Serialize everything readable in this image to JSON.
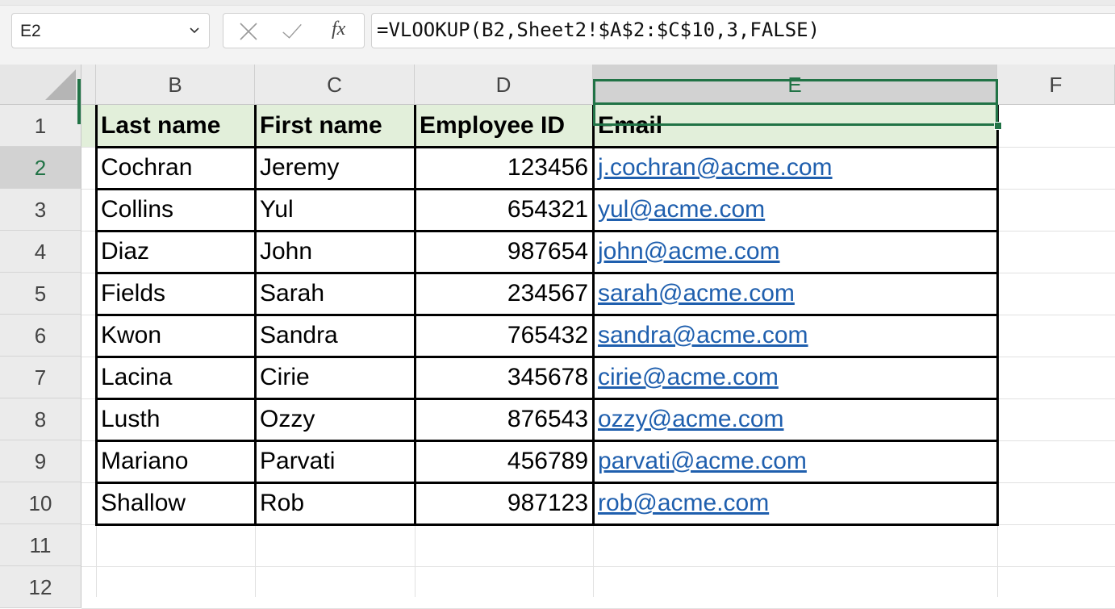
{
  "formula_bar": {
    "name_box": "E2",
    "fx": "fx",
    "formula": "=VLOOKUP(B2,Sheet2!$A$2:$C$10,3,FALSE)"
  },
  "columns": [
    "B",
    "C",
    "D",
    "E",
    "F"
  ],
  "selected_column": "E",
  "rows": [
    "1",
    "2",
    "3",
    "4",
    "5",
    "6",
    "7",
    "8",
    "9",
    "10",
    "11",
    "12"
  ],
  "selected_row": "2",
  "table": {
    "headers": [
      "Last name",
      "First name",
      "Employee ID",
      "Email"
    ],
    "records": [
      [
        "Cochran",
        "Jeremy",
        "123456",
        "j.cochran@acme.com"
      ],
      [
        "Collins",
        "Yul",
        "654321",
        "yul@acme.com"
      ],
      [
        "Diaz",
        "John",
        "987654",
        "john@acme.com"
      ],
      [
        "Fields",
        "Sarah",
        "234567",
        "sarah@acme.com"
      ],
      [
        "Kwon",
        "Sandra",
        "765432",
        "sandra@acme.com"
      ],
      [
        "Lacina",
        "Cirie",
        "345678",
        "cirie@acme.com"
      ],
      [
        "Lusth",
        "Ozzy",
        "876543",
        "ozzy@acme.com"
      ],
      [
        "Mariano",
        "Parvati",
        "456789",
        "parvati@acme.com"
      ],
      [
        "Shallow",
        "Rob",
        "987123",
        "rob@acme.com"
      ]
    ]
  },
  "colors": {
    "accent": "#217346",
    "header_fill": "#e2efda",
    "link": "#1f5fae"
  },
  "icons": [
    "chevron-down-icon",
    "cancel-icon",
    "confirm-icon",
    "fx-icon",
    "select-all-icon"
  ]
}
